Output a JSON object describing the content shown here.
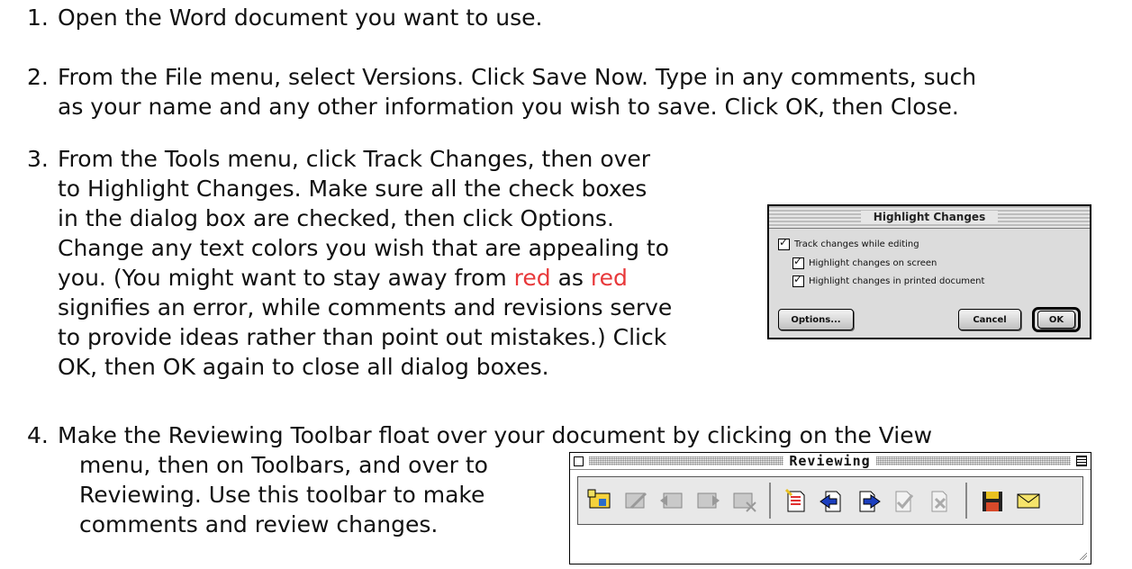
{
  "steps": [
    {
      "num": "1.",
      "lines": [
        "Open the Word document you want to use."
      ]
    },
    {
      "num": "2.",
      "lines": [
        "From the File menu, select Versions.  Click Save Now.  Type in any comments, such",
        "as your name and any other information you wish to save.  Click OK, then Close."
      ]
    },
    {
      "num": "3.",
      "lines": [
        "From the Tools menu, click Track Changes, then over",
        "to Highlight Changes.  Make sure all  the check boxes",
        "in the dialog box are checked, then click Options.",
        "Change any text colors you wish that are appealing to",
        "you.  (You might want to stay away from ",
        "red",
        " as ",
        "red",
        "signifies an error, while comments and revisions serve",
        "to provide ideas rather than point out mistakes.) Click",
        "OK, then OK again to close all dialog boxes."
      ]
    },
    {
      "num": "4.",
      "lines": [
        "Make the Reviewing Toolbar float over your document by clicking on the View",
        "menu, then on Toolbars, and over to",
        "Reviewing.  Use this toolbar to make",
        "comments and review changes."
      ]
    }
  ],
  "dialog": {
    "title": "Highlight Changes",
    "checkboxes": [
      "Track changes while editing",
      "Highlight changes on screen",
      "Highlight changes in printed document"
    ],
    "buttons": {
      "options": "Options...",
      "cancel": "Cancel",
      "ok": "OK"
    }
  },
  "toolbar": {
    "title": "Reviewing",
    "icons": [
      "insert-comment-icon",
      "edit-comment-icon",
      "previous-comment-icon",
      "next-comment-icon",
      "delete-comment-icon",
      "track-changes-icon",
      "previous-change-icon",
      "next-change-icon",
      "accept-change-icon",
      "reject-change-icon",
      "highlight-icon",
      "save-version-icon",
      "send-mail-icon"
    ]
  },
  "colors": {
    "emphasis": "#e8383a"
  }
}
